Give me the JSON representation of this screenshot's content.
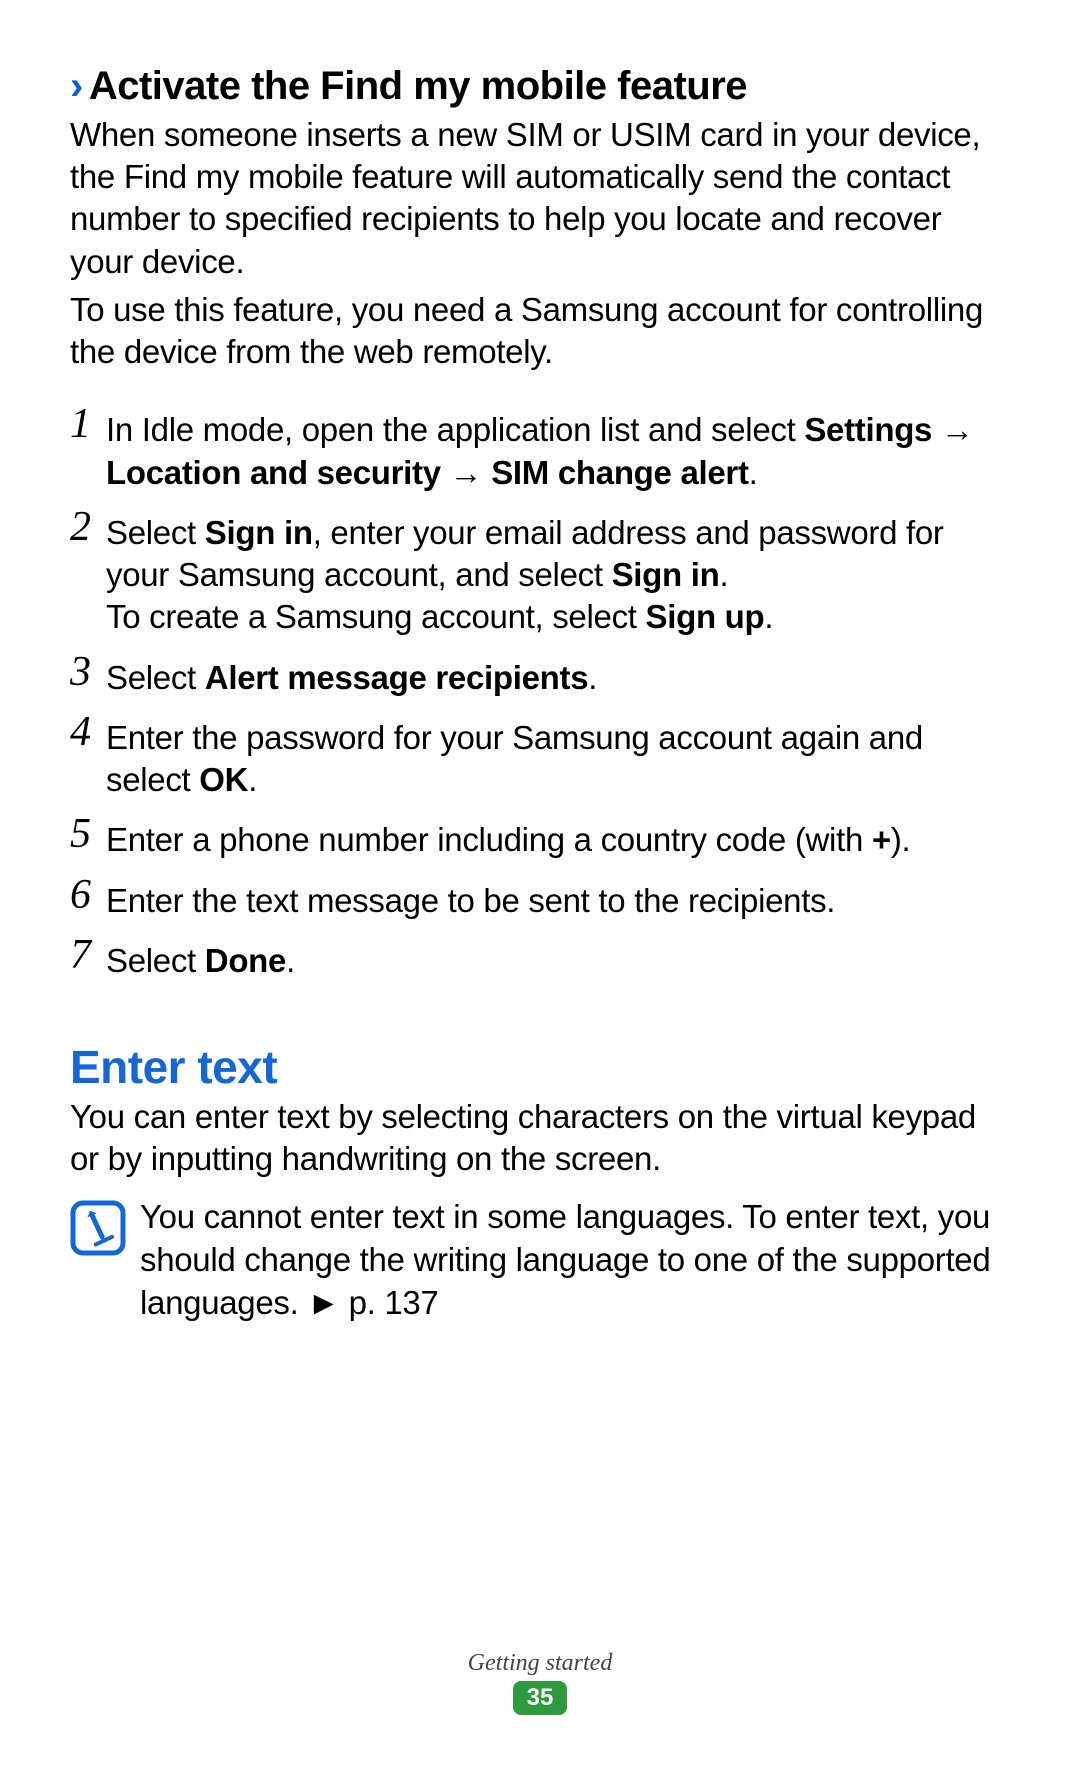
{
  "sub_title_marker": "›",
  "sub_title": "Activate the Find my mobile feature",
  "para1": "When someone inserts a new SIM or USIM card in your device, the Find my mobile feature will automatically send the contact number to specified recipients to help you locate and recover your device.",
  "para2": "To use this feature, you need a Samsung account for controlling the device from the web remotely.",
  "steps": {
    "n1": "1",
    "n2": "2",
    "n3": "3",
    "n4": "4",
    "n5": "5",
    "n6": "6",
    "n7": "7",
    "s1_a": "In Idle mode, open the application list and select ",
    "s1_b": "Settings",
    "s1_c": " → ",
    "s1_d": "Location and security",
    "s1_e": " → ",
    "s1_f": "SIM change alert",
    "s1_g": ".",
    "s2_a": "Select ",
    "s2_b": "Sign in",
    "s2_c": ", enter your email address and password for your Samsung account, and select ",
    "s2_d": "Sign in",
    "s2_e": ".",
    "s2_line2_a": "To create a Samsung account, select ",
    "s2_line2_b": "Sign up",
    "s2_line2_c": ".",
    "s3_a": "Select ",
    "s3_b": "Alert message recipients",
    "s3_c": ".",
    "s4_a": "Enter the password for your Samsung account again and select ",
    "s4_b": "OK",
    "s4_c": ".",
    "s5_a": "Enter a phone number including a country code (with ",
    "s5_b": "+",
    "s5_c": ").",
    "s6": "Enter the text message to be sent to the recipients.",
    "s7_a": "Select ",
    "s7_b": "Done",
    "s7_c": "."
  },
  "section2_title": "Enter text",
  "section2_para": "You can enter text by selecting characters on the virtual keypad or by inputting handwriting on the screen.",
  "note_text_a": "You cannot enter text in some languages. To enter text, you should change the writing language to one of the supported languages. ",
  "note_text_b": "► p. 137",
  "footer_section": "Getting started",
  "footer_page": "35"
}
